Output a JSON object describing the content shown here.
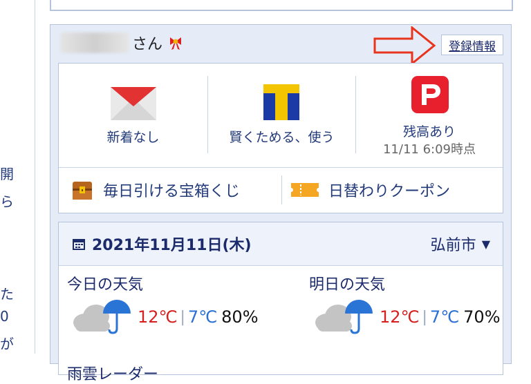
{
  "left_column": {
    "lines": [
      "開",
      "ら",
      "た",
      "0",
      "が"
    ]
  },
  "user": {
    "name_suffix": "さん"
  },
  "registration_link": "登録情報",
  "services": [
    {
      "name": "mail",
      "label": "新着なし"
    },
    {
      "name": "tpoint",
      "label": "賢くためる、使う"
    },
    {
      "name": "paypay",
      "label": "残高あり",
      "sublabel": "11/11 6:09時点"
    }
  ],
  "features": [
    {
      "name": "treasure",
      "label": "毎日引ける宝箱くじ"
    },
    {
      "name": "coupon",
      "label": "日替わりクーポン"
    }
  ],
  "weather": {
    "date": "2021年11月11日(木)",
    "city": "弘前市",
    "today": {
      "title": "今日の天気",
      "high": "12℃",
      "low": "7℃",
      "precip": "80%"
    },
    "tomorrow": {
      "title": "明日の天気",
      "high": "12℃",
      "low": "7℃",
      "precip": "70%"
    },
    "radar_title": "雨雲レーダー"
  },
  "colors": {
    "link": "#223a7a",
    "high_temp": "#d62020",
    "low_temp": "#2a6fd6",
    "module_bg": "#e5ecf8",
    "arrow": "#e8341c"
  }
}
